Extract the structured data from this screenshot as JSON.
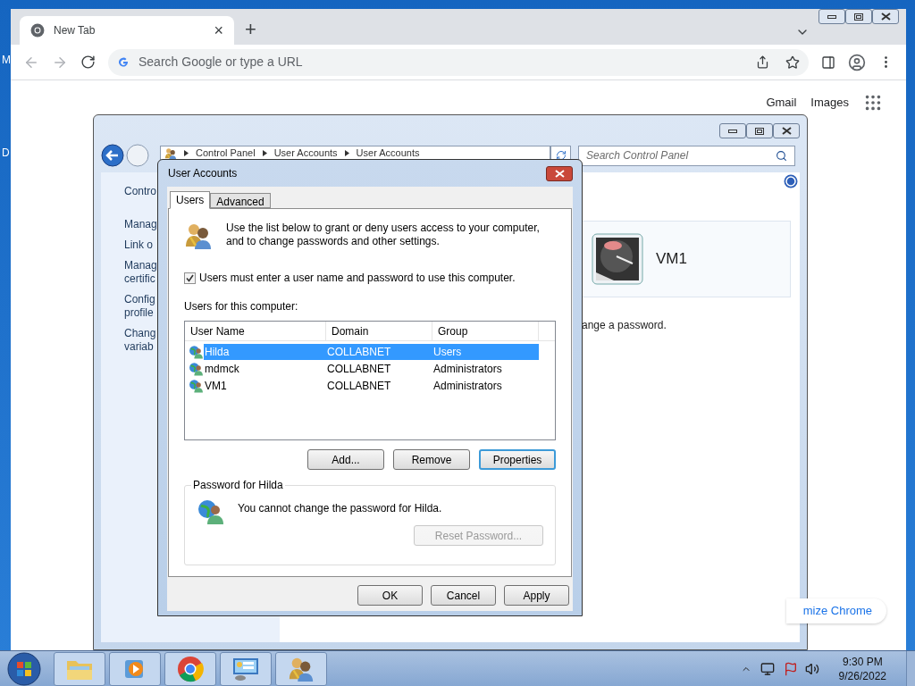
{
  "desktop": {
    "icon_labels": [
      "M",
      "D"
    ]
  },
  "chrome": {
    "tab": {
      "title": "New Tab",
      "close": "×"
    },
    "new_tab": "+",
    "omnibox": {
      "placeholder": "Search Google or type a URL"
    },
    "links": [
      "Gmail",
      "Images"
    ],
    "customize_button": "mize Chrome"
  },
  "control_panel": {
    "breadcrumb": [
      "Control Panel",
      "User Accounts",
      "User Accounts"
    ],
    "search": {
      "placeholder": "Search Control Panel"
    },
    "sidebar_items": [
      [
        "Contro"
      ],
      [
        "Manag"
      ],
      [
        "Link o"
      ],
      [
        "Manag",
        "certific"
      ],
      [
        "Config",
        "profile"
      ],
      [
        "Chang",
        "variab"
      ]
    ],
    "account_card": {
      "name": "VM1"
    },
    "partial_text": "ange a password."
  },
  "dialog": {
    "title": "User Accounts",
    "tabs": [
      {
        "label": "Users",
        "selected": true
      },
      {
        "label": "Advanced",
        "selected": false
      }
    ],
    "intro": "Use the list below to grant or deny users access to your computer,\nand to change passwords and other settings.",
    "require_password": {
      "label": "Users must enter a user name and password to use this computer.",
      "checked": true
    },
    "list_label": "Users for this computer:",
    "table": {
      "columns": [
        "User Name",
        "Domain",
        "Group"
      ],
      "rows": [
        {
          "cells": [
            "Hilda",
            "COLLABNET",
            "Users"
          ],
          "selected": true
        },
        {
          "cells": [
            "mdmck",
            "COLLABNET",
            "Administrators"
          ],
          "selected": false
        },
        {
          "cells": [
            "VM1",
            "COLLABNET",
            "Administrators"
          ],
          "selected": false
        }
      ]
    },
    "buttons": [
      {
        "label": "Add...",
        "focused": false
      },
      {
        "label": "Remove",
        "focused": false
      },
      {
        "label": "Properties",
        "focused": true
      }
    ],
    "password_group": {
      "title": "Password for Hilda",
      "message": "You cannot change the password for Hilda.",
      "reset_button": {
        "label": "Reset Password...",
        "disabled": true
      }
    },
    "footer_buttons": [
      "OK",
      "Cancel",
      "Apply"
    ]
  },
  "taskbar": {
    "items": [
      {
        "kind": "folder"
      },
      {
        "kind": "media"
      },
      {
        "kind": "browser"
      },
      {
        "kind": "control-panel"
      },
      {
        "kind": "users"
      }
    ],
    "clock": {
      "time": "9:30 PM",
      "date": "9/26/2022"
    }
  }
}
